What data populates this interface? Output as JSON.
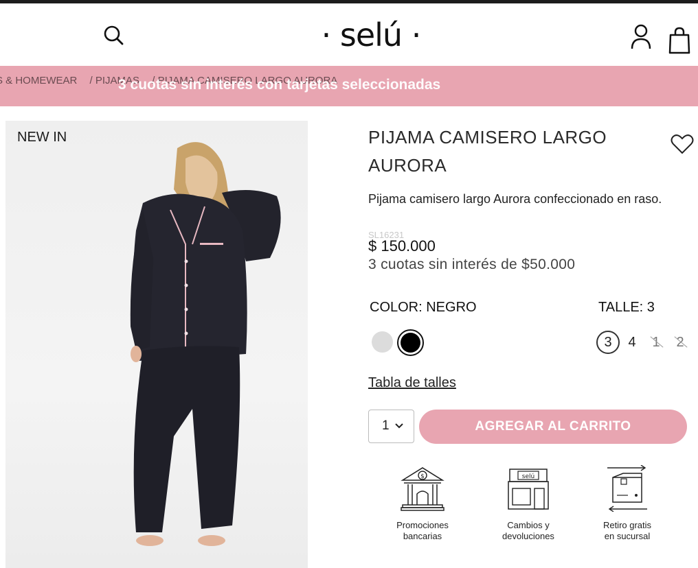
{
  "header": {
    "logo": "· selú ·",
    "icons": [
      "search-icon",
      "user-icon",
      "shopping-bag-icon"
    ]
  },
  "promo": {
    "breadcrumb": [
      "S & HOMEWEAR",
      "/ PIJAMAS",
      "/ PIJAMA CAMISERO LARGO AURORA"
    ],
    "banner_text": "3 cuotas sin interés con tarjetas seleccionadas",
    "color": "#e8a5b1"
  },
  "product": {
    "badge": "NEW IN",
    "title": "PIJAMA CAMISERO LARGO AURORA",
    "description": "Pijama camisero largo Aurora confeccionado en raso.",
    "sku": "SL16231",
    "price": "$ 150.000",
    "installments": "3 cuotas sin interés de $50.000",
    "color_label": "COLOR: NEGRO",
    "size_label": "TALLE: 3",
    "colors": [
      {
        "name": "gris claro",
        "hex": "#dcdcdc",
        "selected": false
      },
      {
        "name": "negro",
        "hex": "#000000",
        "selected": true
      }
    ],
    "sizes": [
      {
        "label": "3",
        "selected": true,
        "available": true
      },
      {
        "label": "4",
        "selected": false,
        "available": true
      },
      {
        "label": "1",
        "selected": false,
        "available": false
      },
      {
        "label": "2",
        "selected": false,
        "available": false
      }
    ],
    "size_table_link": "Tabla de talles",
    "quantity": "1",
    "add_to_cart": "AGREGAR AL CARRITO"
  },
  "features": [
    {
      "icon": "bank-icon",
      "label_line1": "Promociones",
      "label_line2": "bancarias"
    },
    {
      "icon": "store-icon",
      "label_line1": "Cambios y",
      "label_line2": "devoluciones",
      "sign": "selú"
    },
    {
      "icon": "package-return-icon",
      "label_line1": "Retiro gratis",
      "label_line2": "en sucursal"
    }
  ]
}
